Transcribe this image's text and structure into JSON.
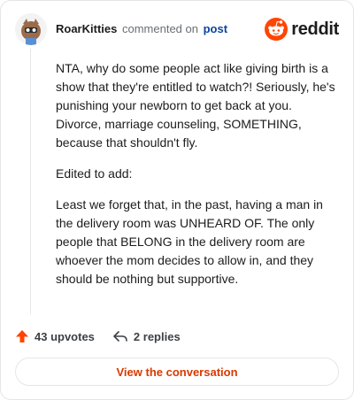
{
  "header": {
    "username": "RoarKitties",
    "verb": "commented on",
    "post_link": "post",
    "brand_name": "reddit"
  },
  "comment": {
    "paragraphs": [
      "NTA, why do some people act like giving birth is a show that they're entitled to watch?! Seriously, he's punishing your newborn to get back at you. Divorce, marriage counseling, SOMETHING, because that shouldn't fly.",
      "Edited to add:",
      "Least we forget that, in the past, having a man in the delivery room was UNHEARD OF. The only people that BELONG in the delivery room are whoever the mom decides to allow in, and they should be nothing but supportive."
    ]
  },
  "actions": {
    "upvotes": "43 upvotes",
    "replies": "2 replies"
  },
  "cta": {
    "label": "View the conversation"
  },
  "colors": {
    "accent": "#d93900",
    "reddit_orange": "#ff4500",
    "link": "#0a449b"
  },
  "icons": {
    "upvote": "upvote-arrow-icon",
    "reply": "reply-arrow-icon",
    "brand": "reddit-logo-icon"
  }
}
